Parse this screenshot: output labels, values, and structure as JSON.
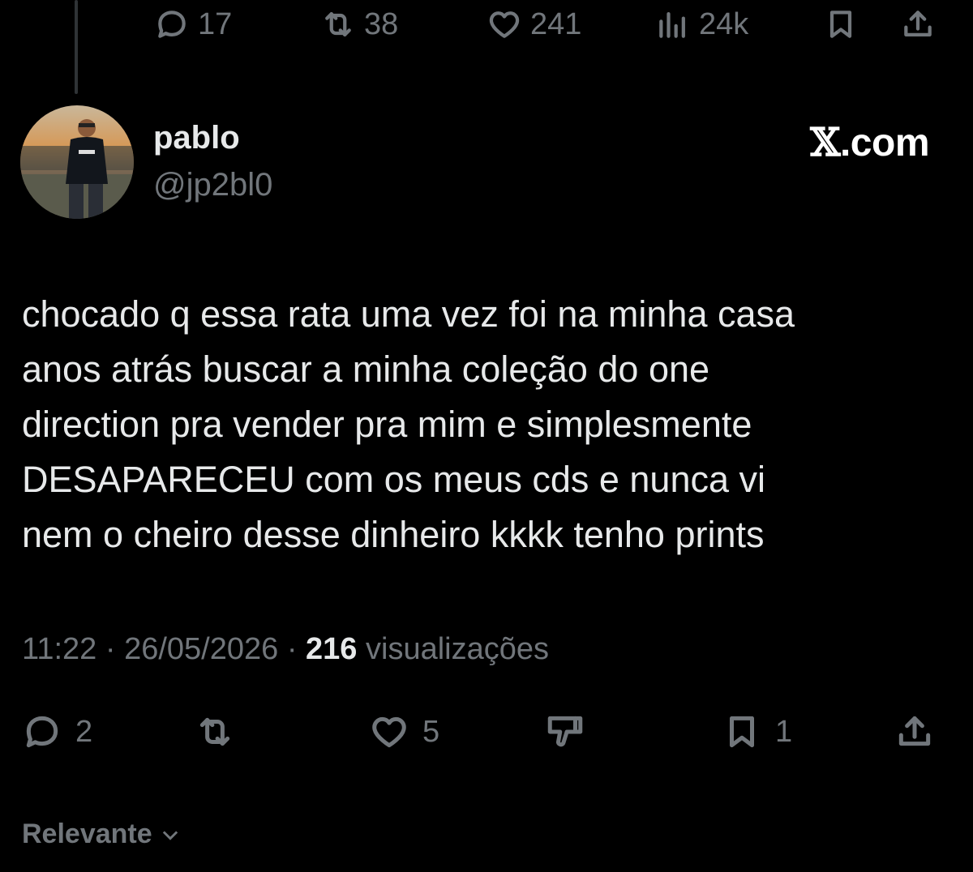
{
  "top_actions": {
    "replies": "17",
    "reposts": "38",
    "likes": "241",
    "views": "24k"
  },
  "author": {
    "display_name": "pablo",
    "handle": "@jp2bl0"
  },
  "brand": {
    "x": "𝕏",
    "domain": ".com"
  },
  "tweet": {
    "text": "chocado q essa rata uma vez foi na minha casa\nanos atrás buscar a minha coleção do one\ndirection pra vender pra mim e simplesmente\nDESAPARECEU com os meus cds e nunca vi\nnem o cheiro desse dinheiro kkkk tenho prints",
    "time": "11:22",
    "date": "26/05/2026",
    "views_count": "216",
    "views_label": "visualizações"
  },
  "bottom_actions": {
    "replies": "2",
    "likes": "5",
    "bookmarks": "1"
  },
  "sort": {
    "label": "Relevante"
  }
}
